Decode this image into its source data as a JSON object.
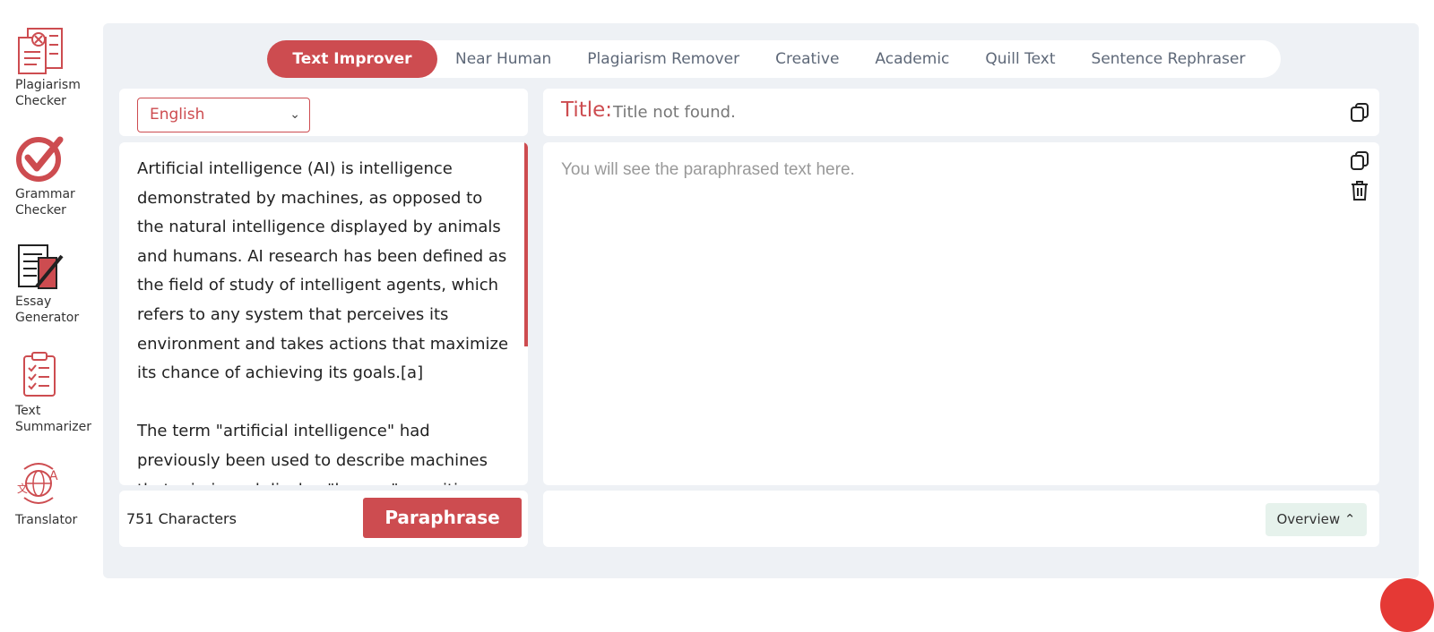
{
  "sidebar": {
    "items": [
      {
        "label": "Plagiarism Checker",
        "icon": "plagiarism-icon"
      },
      {
        "label": "Grammar Checker",
        "icon": "grammar-check-icon"
      },
      {
        "label": "Essay Generator",
        "icon": "essay-icon"
      },
      {
        "label": "Text Summarizer",
        "icon": "summarizer-icon"
      },
      {
        "label": "Translator",
        "icon": "translator-icon"
      }
    ]
  },
  "modes": [
    {
      "label": "Text Improver",
      "active": true
    },
    {
      "label": "Near Human"
    },
    {
      "label": "Plagiarism Remover"
    },
    {
      "label": "Creative"
    },
    {
      "label": "Academic"
    },
    {
      "label": "Quill Text"
    },
    {
      "label": "Sentence Rephraser"
    }
  ],
  "language": {
    "selected": "English"
  },
  "title": {
    "label": "Title:",
    "value": "Title not found."
  },
  "input": {
    "text": "Artificial intelligence (AI) is intelligence demonstrated by machines, as opposed to the natural intelligence displayed by animals and humans. AI research has been defined as the field of study of intelligent agents, which refers to any system that perceives its environment and takes actions that maximize its chance of achieving its goals.[a]\n\nThe term \"artificial intelligence\" had previously been used to describe machines that mimic and display \"human\" cognitive skills"
  },
  "output": {
    "placeholder": "You will see the paraphrased text here."
  },
  "footer": {
    "char_count": "751 Characters",
    "paraphrase_label": "Paraphrase",
    "overview_label": "Overview"
  },
  "colors": {
    "accent": "#cd4c50",
    "panel_bg": "#eef1f5",
    "overview_bg": "#e6f2ec"
  }
}
